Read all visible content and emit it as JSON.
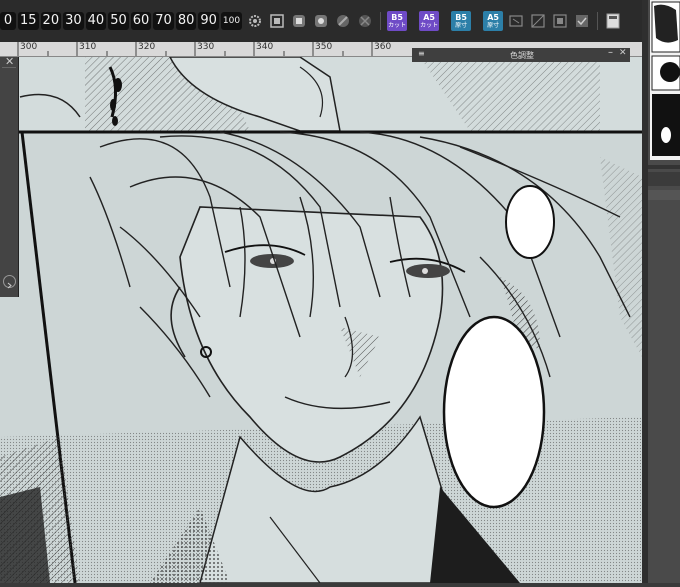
{
  "toolbar": {
    "zoom_presets": [
      "0",
      "15",
      "20",
      "30",
      "40",
      "50",
      "60",
      "70",
      "80",
      "90",
      "100"
    ],
    "paper_buttons": [
      {
        "top": "B5",
        "bottom": "カット",
        "color": "#6f4bc6"
      },
      {
        "top": "A5",
        "bottom": "カット",
        "color": "#6f4bc6"
      },
      {
        "top": "B5",
        "bottom": "原寸",
        "color": "#2c7fa8"
      },
      {
        "top": "A5",
        "bottom": "原寸",
        "color": "#2c7fa8"
      }
    ]
  },
  "ruler": {
    "ticks": [
      "300",
      "310",
      "320",
      "330",
      "340",
      "350",
      "360"
    ]
  },
  "panels": {
    "navigator_title": "色調整",
    "close_glyph": "✕"
  },
  "icons": {
    "settings": "gear-icon",
    "fit": "fit-window-icon",
    "rotate": "rotate-icon",
    "flip": "flip-icon",
    "page": "page-icon"
  }
}
